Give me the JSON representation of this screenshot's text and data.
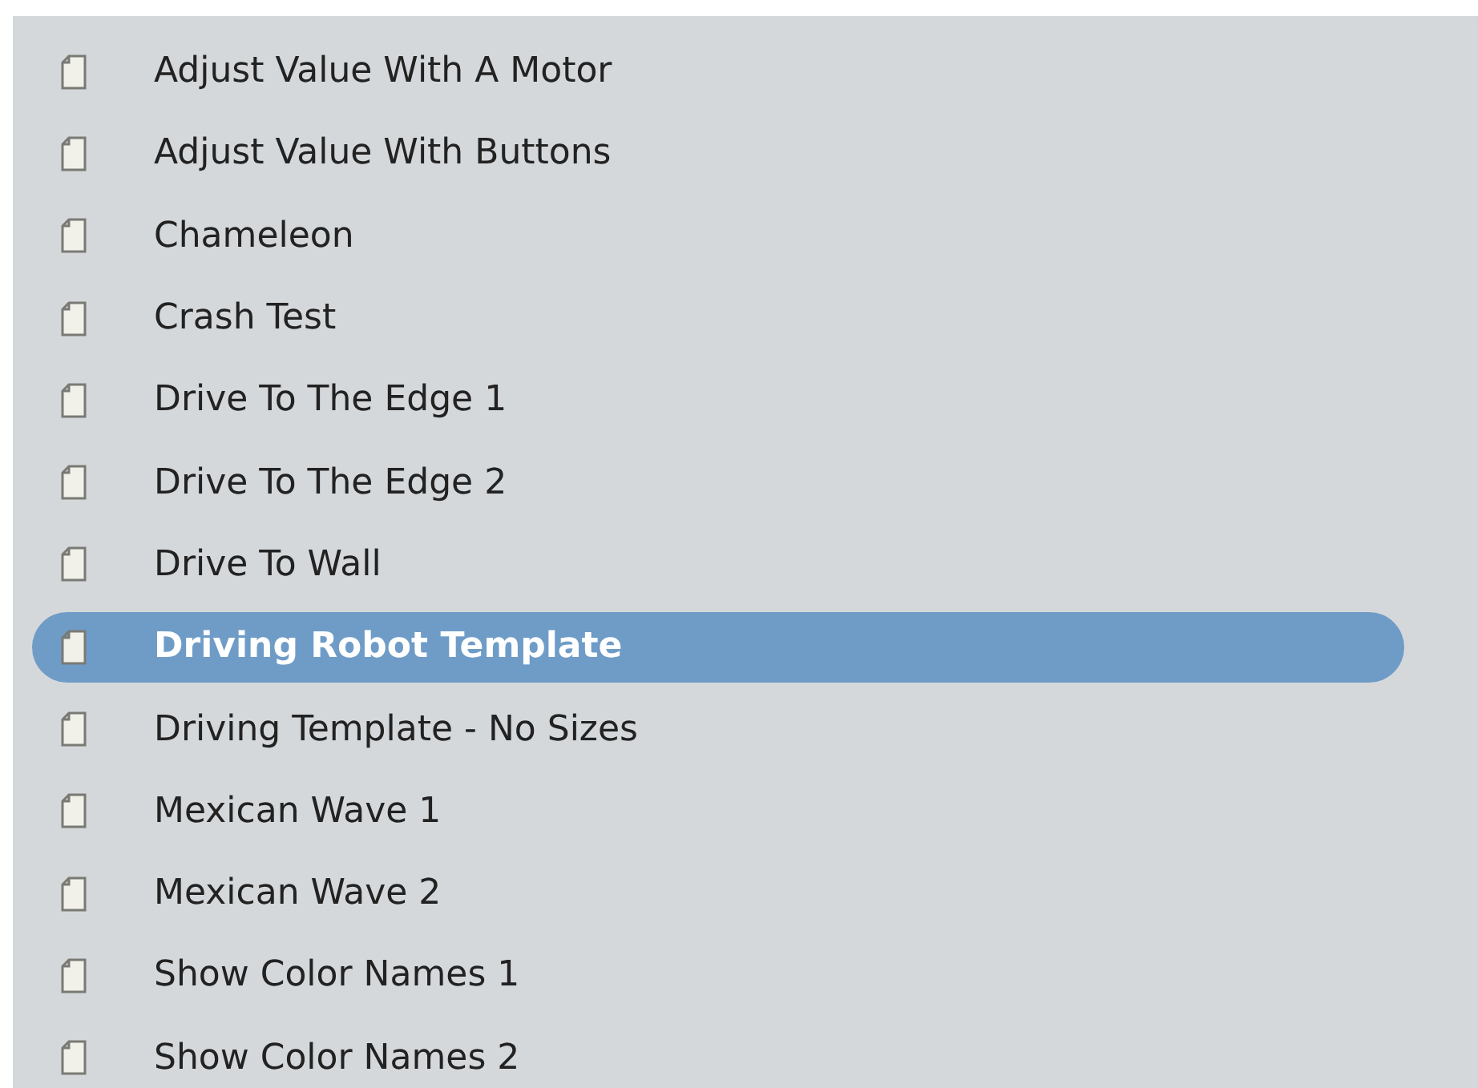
{
  "files": [
    {
      "label": "Adjust Value With A Motor",
      "selected": false
    },
    {
      "label": "Adjust Value With Buttons",
      "selected": false
    },
    {
      "label": "Chameleon",
      "selected": false
    },
    {
      "label": "Crash Test",
      "selected": false
    },
    {
      "label": "Drive To The Edge 1",
      "selected": false
    },
    {
      "label": "Drive To The Edge 2",
      "selected": false
    },
    {
      "label": "Drive To Wall",
      "selected": false
    },
    {
      "label": "Driving Robot Template",
      "selected": true
    },
    {
      "label": "Driving Template - No Sizes",
      "selected": false
    },
    {
      "label": "Mexican Wave 1",
      "selected": false
    },
    {
      "label": "Mexican Wave 2",
      "selected": false
    },
    {
      "label": "Show Color Names 1",
      "selected": false
    },
    {
      "label": "Show Color Names 2",
      "selected": false
    }
  ]
}
